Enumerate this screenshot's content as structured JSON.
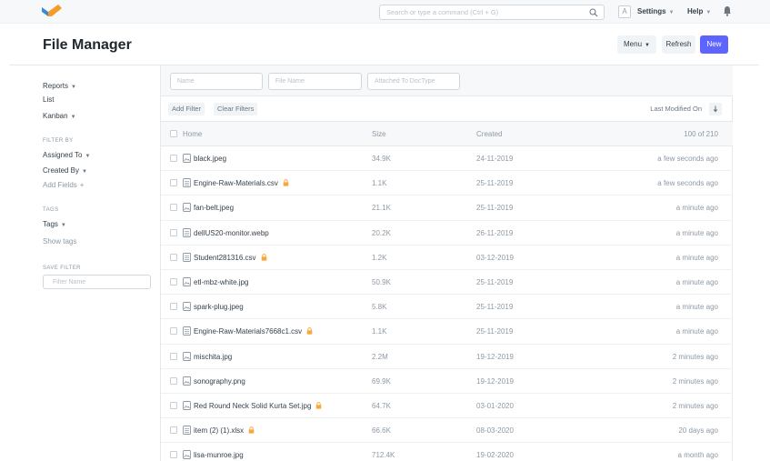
{
  "navbar": {
    "search_placeholder": "Search or type a command (Ctrl + G)",
    "avatar_initial": "A",
    "settings_label": "Settings",
    "help_label": "Help"
  },
  "page": {
    "title": "File Manager",
    "menu_label": "Menu",
    "refresh_label": "Refresh",
    "new_label": "New"
  },
  "sidebar": {
    "reports": "Reports",
    "list": "List",
    "kanban": "Kanban",
    "filter_by_heading": "FILTER BY",
    "assigned_to": "Assigned To",
    "created_by": "Created By",
    "add_fields": "Add Fields",
    "tags_heading": "TAGS",
    "tags": "Tags",
    "show_tags": "Show tags",
    "save_filter_heading": "SAVE FILTER",
    "filter_name_placeholder": "Filter Name"
  },
  "filters": {
    "name_placeholder": "Name",
    "file_name_placeholder": "File Name",
    "attached_placeholder": "Attached To DocType",
    "add_filter": "Add Filter",
    "clear_filters": "Clear Filters",
    "sort_label": "Last Modified On"
  },
  "table": {
    "headers": {
      "home": "Home",
      "size": "Size",
      "created": "Created",
      "count": "100 of 210"
    },
    "rows": [
      {
        "name": "black.jpeg",
        "type": "image",
        "locked": false,
        "size": "34.9K",
        "created": "24-11-2019",
        "modified": "a few seconds ago"
      },
      {
        "name": "Engine-Raw-Materials.csv",
        "type": "doc",
        "locked": true,
        "size": "1.1K",
        "created": "25-11-2019",
        "modified": "a few seconds ago"
      },
      {
        "name": "fan-belt.jpeg",
        "type": "image",
        "locked": false,
        "size": "21.1K",
        "created": "25-11-2019",
        "modified": "a minute ago"
      },
      {
        "name": "dellUS20-monitor.webp",
        "type": "doc",
        "locked": false,
        "size": "20.2K",
        "created": "26-11-2019",
        "modified": "a minute ago"
      },
      {
        "name": "Student281316.csv",
        "type": "doc",
        "locked": true,
        "size": "1.2K",
        "created": "03-12-2019",
        "modified": "a minute ago"
      },
      {
        "name": "etl-mbz-white.jpg",
        "type": "image",
        "locked": false,
        "size": "50.9K",
        "created": "25-11-2019",
        "modified": "a minute ago"
      },
      {
        "name": "spark-plug.jpeg",
        "type": "image",
        "locked": false,
        "size": "5.8K",
        "created": "25-11-2019",
        "modified": "a minute ago"
      },
      {
        "name": "Engine-Raw-Materials7668c1.csv",
        "type": "doc",
        "locked": true,
        "size": "1.1K",
        "created": "25-11-2019",
        "modified": "a minute ago"
      },
      {
        "name": "mischita.jpg",
        "type": "image",
        "locked": false,
        "size": "2.2M",
        "created": "19-12-2019",
        "modified": "2 minutes ago"
      },
      {
        "name": "sonography.png",
        "type": "image",
        "locked": false,
        "size": "69.9K",
        "created": "19-12-2019",
        "modified": "2 minutes ago"
      },
      {
        "name": "Red Round Neck Solid Kurta Set.jpg",
        "type": "image",
        "locked": true,
        "size": "64.7K",
        "created": "03-01-2020",
        "modified": "2 minutes ago"
      },
      {
        "name": "item (2) (1).xlsx",
        "type": "doc",
        "locked": true,
        "size": "66.6K",
        "created": "08-03-2020",
        "modified": "20 days ago"
      },
      {
        "name": "lisa-munroe.jpg",
        "type": "image",
        "locked": false,
        "size": "712.4K",
        "created": "19-02-2020",
        "modified": "a month ago"
      }
    ]
  },
  "colors": {
    "primary": "#5e64ff",
    "lock": "#f8a73b",
    "logo_blue": "#3a8bd0",
    "logo_orange": "#f79a2a"
  }
}
